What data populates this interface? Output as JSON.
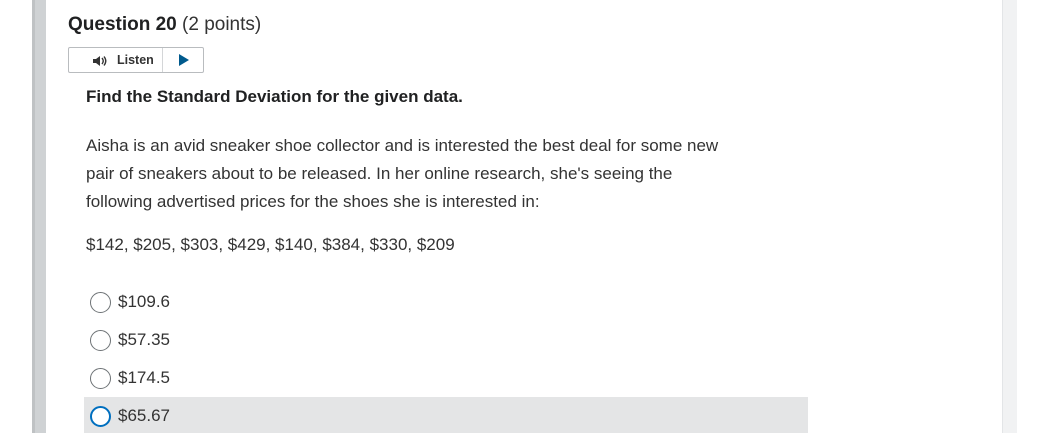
{
  "question": {
    "title": "Question 20",
    "points": "(2 points)"
  },
  "listen": {
    "label": "Listen",
    "speaker_icon": "speaker-icon",
    "play_icon": "play-icon",
    "accent_color": "#005a8d"
  },
  "instruction": "Find the Standard Deviation for the given data.",
  "body": {
    "line1": "Aisha is an avid sneaker shoe collector and is interested the best deal for some new",
    "line2": "pair of sneakers about to be released. In her online research, she's seeing the",
    "line3": "following advertised prices for the shoes she is interested in:"
  },
  "data_values": "$142, $205, $303, $429, $140, $384, $330, $209",
  "options": [
    {
      "label": "$109.6",
      "highlighted": false
    },
    {
      "label": "$57.35",
      "highlighted": false
    },
    {
      "label": "$174.5",
      "highlighted": false
    },
    {
      "label": "$65.67",
      "highlighted": true
    }
  ],
  "colors": {
    "highlight_bg": "#e4e5e6",
    "focus_ring": "#006fbf"
  }
}
